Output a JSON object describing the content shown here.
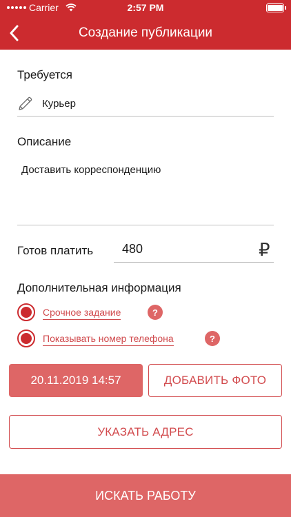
{
  "status_bar": {
    "carrier": "Carrier",
    "time": "2:57 PM",
    "icons": [
      "signal-dots",
      "wifi-icon",
      "battery-icon"
    ]
  },
  "nav": {
    "title": "Создание публикации",
    "back_icon": "chevron-left-icon"
  },
  "form": {
    "required_label": "Требуется",
    "required_value": "Курьер",
    "required_icon": "pencil-icon",
    "description_label": "Описание",
    "description_value": "Доставить корреспонденцию",
    "pay_label": "Готов платить",
    "pay_value": "480",
    "currency_symbol": "₽",
    "extra_label": "Дополнительная информация",
    "options": [
      {
        "label": "Срочное задание",
        "selected": true,
        "help": "?"
      },
      {
        "label": "Показывать номер телефона",
        "selected": true,
        "help": "?"
      }
    ]
  },
  "actions": {
    "datetime": "20.11.2019  14:57",
    "add_photo": "ДОБАВИТЬ ФОТО",
    "set_address": "УКАЗАТЬ АДРЕС",
    "search_work": "ИСКАТЬ РАБОТУ"
  },
  "colors": {
    "brand_red": "#cc2b2f",
    "light_red": "#de6666",
    "link_red": "#d04a4d"
  }
}
